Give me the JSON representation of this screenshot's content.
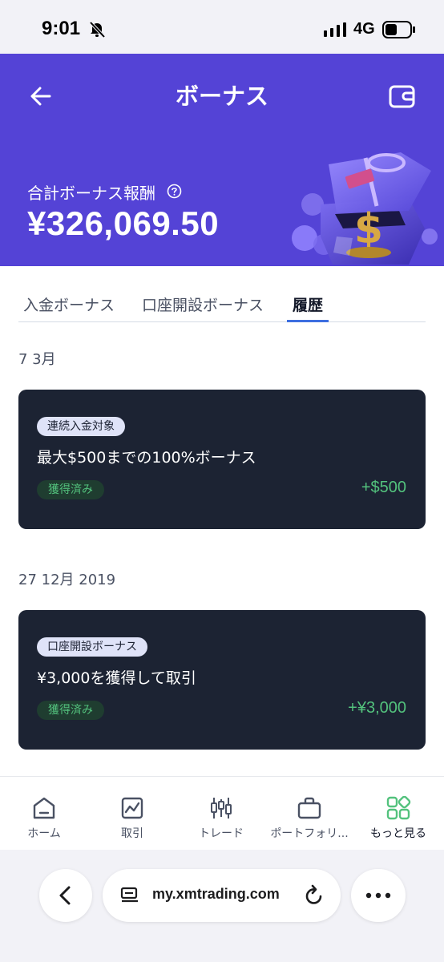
{
  "status_bar": {
    "time": "9:01",
    "network": "4G"
  },
  "header": {
    "title": "ボーナス",
    "bonus_label": "合計ボーナス報酬",
    "bonus_amount": "¥326,069.50",
    "background_color": "#5443d6"
  },
  "tabs": [
    {
      "label": "入金ボーナス",
      "active": false
    },
    {
      "label": "口座開設ボーナス",
      "active": false
    },
    {
      "label": "履歴",
      "active": true
    }
  ],
  "history": [
    {
      "date": "7 3月",
      "tag": "連続入金対象",
      "title": "最大$500までの100%ボーナス",
      "status": "獲得済み",
      "amount": "+$500"
    },
    {
      "date": "27 12月 2019",
      "tag": "口座開設ボーナス",
      "title": "¥3,000を獲得して取引",
      "status": "獲得済み",
      "amount": "+¥3,000"
    }
  ],
  "bottom_nav": [
    {
      "label": "ホーム",
      "icon": "home-icon"
    },
    {
      "label": "取引",
      "icon": "chart-icon"
    },
    {
      "label": "トレード",
      "icon": "candlestick-icon"
    },
    {
      "label": "ポートフォリ...",
      "icon": "briefcase-icon"
    },
    {
      "label": "もっと見る",
      "icon": "grid-icon",
      "active": true
    }
  ],
  "browser": {
    "url": "my.xmtrading.com"
  },
  "colors": {
    "accent": "#5443d6",
    "card": "#1c2333",
    "positive": "#53c27d",
    "tab_indicator": "#3d6fe0"
  }
}
